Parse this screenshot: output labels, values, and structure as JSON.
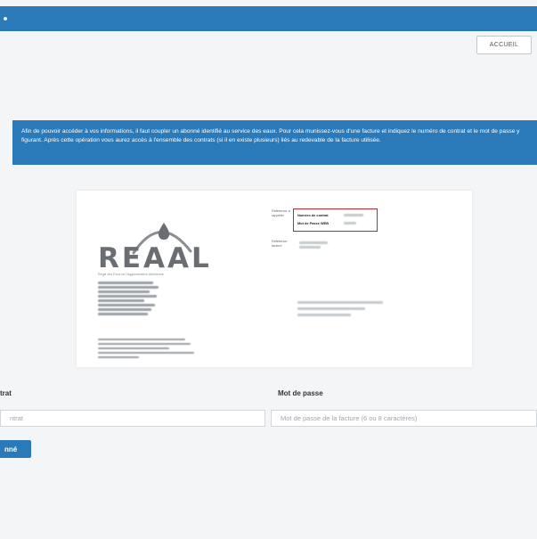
{
  "header": {
    "accueil_label": "ACCUEIL"
  },
  "info_banner": {
    "text": "Afin de pouvoir accéder à vos informations, il faut coupler un abonné identifié au service des eaux. Pour cela munissez-vous d'une facture et indiquez le numéro de contrat et le mot de passe y figurant. Après cette opération vous aurez accès à l'ensemble des contrats (si il en existe plusieurs) liés au redevable de la facture utilisée."
  },
  "invoice": {
    "logo_text": "REAAL",
    "logo_subtitle": "Régie des Eaux de l'Agglomération Arlésienne",
    "reference_label": "Référence à rappeler",
    "contract_number_label": "Numéro de contrat",
    "web_password_label": "Mot de Passe WEB",
    "invoice_date_label": "Référence facture",
    "colors": {
      "highlight_box": "#c2272d",
      "logo_gray": "#6a6e72"
    }
  },
  "form": {
    "contract_label": "trat",
    "contract_placeholder": "ntrat",
    "password_label": "Mot de passe",
    "password_placeholder": "Mot de passe de la facture (6 ou 8 caractères)",
    "submit_label": "nné"
  },
  "colors": {
    "primary": "#2a7ab9",
    "background": "#f4f5f7"
  }
}
